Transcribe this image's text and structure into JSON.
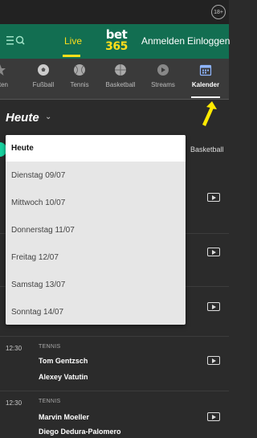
{
  "top": {
    "age_badge": "18+"
  },
  "header": {
    "menu_icon": "menu-icon",
    "search_icon": "search-icon",
    "live": "Live",
    "logo_line1": "bet",
    "logo_line2": "365",
    "login_left": "Anmelden",
    "login_right": "Einloggen",
    "colors": {
      "header_bg": "#126e51",
      "accent": "#ffdf1b"
    }
  },
  "nav": {
    "items": [
      {
        "label": "oriten",
        "icon": "star-icon"
      },
      {
        "label": "Fußball",
        "icon": "soccer-ball-icon"
      },
      {
        "label": "Tennis",
        "icon": "tennis-ball-icon"
      },
      {
        "label": "Basketball",
        "icon": "basketball-icon"
      },
      {
        "label": "Streams",
        "icon": "play-icon"
      },
      {
        "label": "Kalender",
        "icon": "calendar-icon"
      }
    ],
    "active": "Kalender"
  },
  "page": {
    "date_heading": "Heute",
    "filter_basketball": "Basketball"
  },
  "dropdown": {
    "selected": "Heute",
    "options": [
      "Heute",
      "Dienstag 09/07",
      "Mittwoch 10/07",
      "Donnerstag 11/07",
      "Freitag 12/07",
      "Samstag 13/07",
      "Sonntag 14/07"
    ]
  },
  "events": [
    {
      "time": "12:30",
      "sport": "TENNIS",
      "player1": "Tom Gentzsch",
      "player2": "Alexey Vatutin"
    },
    {
      "time": "12:30",
      "sport": "TENNIS",
      "player1": "Marvin Moeller",
      "player2": "Diego Dedura-Palomero"
    }
  ]
}
